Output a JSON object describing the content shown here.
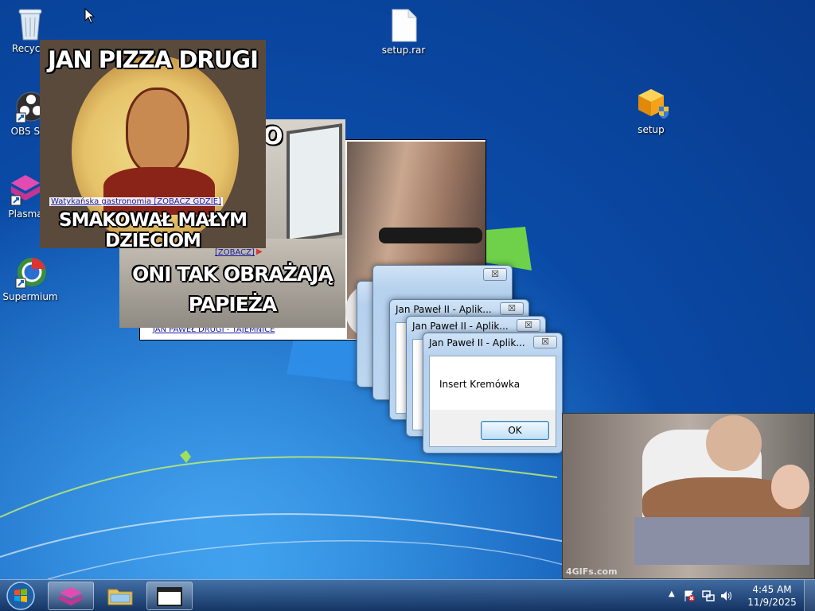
{
  "desktop": {
    "icons": [
      {
        "label": "Recycle",
        "icon": "recycle-bin-icon"
      },
      {
        "label": "OBS Stu",
        "icon": "obs-studio-icon"
      },
      {
        "label": "Plasma",
        "icon": "plasma-icon"
      },
      {
        "label": "Supermium",
        "icon": "supermium-icon"
      },
      {
        "label": "setup.rar",
        "icon": "file-icon"
      },
      {
        "label": "setup",
        "icon": "setup-installer-icon"
      }
    ]
  },
  "memes": {
    "pizza": {
      "top_text": "JAN PIZZA DRUGI",
      "bottom_text": "SMAKOWAŁ MAŁYM DZIECIOM",
      "link": "Watykańska gastronomia [ZOBACZ GDZIE]"
    },
    "office": {
      "top_text": "O",
      "link": "[ZOBACZ]",
      "bottom_line1": "ONI TAK OBRAŻAJĄ",
      "bottom_line2": "PAPIEŻA"
    },
    "back": {
      "link": "JAN PAWEŁ DRUGI - TAJEMNICE"
    },
    "gif": {
      "watermark": "4GIFs.com"
    }
  },
  "dialogs": {
    "title": "Jan Paweł II - Aplik...",
    "close_label": "☒",
    "message": "Insert Kremówka",
    "ok_label": "OK"
  },
  "taskbar": {
    "time": "4:45 AM",
    "date": "11/9/2025",
    "tray_icons": [
      "show-hidden-icons-chevron",
      "action-center-flag-icon",
      "network-icon",
      "volume-icon"
    ]
  },
  "colors": {
    "accent": "#3c7fb1",
    "taskbar": "#1e3f6e"
  }
}
